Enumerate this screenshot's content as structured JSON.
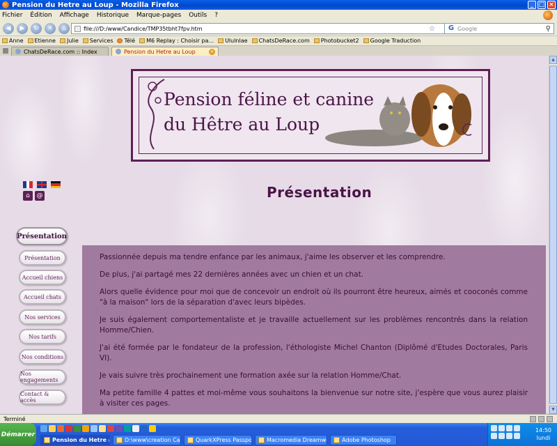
{
  "window": {
    "title": "Pension du Hetre au Loup - Mozilla Firefox"
  },
  "menu": [
    "Fichier",
    "Édition",
    "Affichage",
    "Historique",
    "Marque-pages",
    "Outils",
    "?"
  ],
  "toolbar": {
    "url": "file:///D:/www/Candice/TMP35tbht7fpv.htm",
    "search_placeholder": "Google"
  },
  "bookmarks": [
    "Anne",
    "Etienne",
    "Julie",
    "Services",
    "Télé",
    "M6 Replay : Choisir pa...",
    "Ululnlae",
    "ChatsDeRace.com",
    "Photobucket2",
    "Google Traduction"
  ],
  "tabs": [
    {
      "label": "ChatsDeRace.com :: Index",
      "active": false
    },
    {
      "label": "Pension du Hetre au Loup",
      "active": true
    }
  ],
  "banner": {
    "line1": "Pension féline et canine",
    "line2": "du Hêtre au Loup"
  },
  "page": {
    "heading": "Présentation"
  },
  "nav": {
    "current": "Présentation",
    "items": [
      "Présentation",
      "Accueil chiens",
      "Accueil chats",
      "Nos services",
      "Nos tarifs",
      "Nos conditions",
      "Nos engagements",
      "Contact & accès"
    ]
  },
  "paragraphs": [
    "Passionnée depuis ma tendre enfance par les animaux, j'aime les observer et les comprendre.",
    "De plus, j'ai partagé mes 22 dernières années avec un chien et un chat.",
    "Alors quelle évidence pour moi que de concevoir un endroit où ils pourront être heureux, aimés et cooconés comme \"à la maison\" lors de la séparation d'avec leurs bipèdes.",
    "Je suis également comportementaliste et je travaille actuellement sur les problèmes rencontrés dans la relation Homme/Chien.",
    "J'ai été formée par le fondateur de la profession, l'éthologiste Michel Chanton (Diplômé d'Etudes Doctorales, Paris VI).",
    "Je vais suivre très prochainement une formation axée sur la relation Homme/Chat.",
    "Ma petite famille 4 pattes et moi-même vous souhaitons la bienvenue sur notre site, j'espère que vous aurez plaisir à visiter ces pages."
  ],
  "status": {
    "text": "Terminé"
  },
  "taskbar": {
    "start": "Démarrer",
    "tasks": [
      "Pension du Hetre au L...",
      "D:\\www\\creation Candic...",
      "QuarkXPress Passport (t...",
      "Macromedia Dreamweav...",
      "Adobe Photoshop"
    ],
    "clock_time": "14:50",
    "clock_day": "lundi"
  },
  "colors": {
    "accent": "#5e1f55",
    "panel": "#a07a9f",
    "background": "#e6dbe7"
  }
}
